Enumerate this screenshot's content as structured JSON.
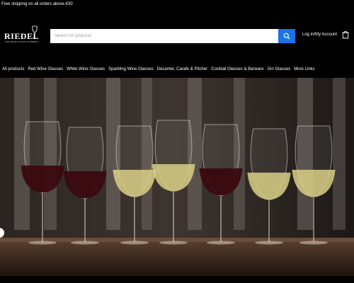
{
  "announcement": {
    "text": "Free shipping on all orders above €30"
  },
  "brand": {
    "name": "RIEDEL",
    "tagline": "THE WINE GLASS COMPANY",
    "icon": "wine-glass-icon"
  },
  "search": {
    "placeholder": "Search for products",
    "icon": "search-icon",
    "button_color": "#1a73e8"
  },
  "account": {
    "label": "Log in/My Account"
  },
  "cart": {
    "icon": "cart-icon"
  },
  "nav": {
    "items": [
      "All products",
      "Red Wine Glasses",
      "White Wine Glasses",
      "Sparkling Wine Glasses",
      "Decanter, Carafe & Pitcher",
      "Cocktail Glasses & Barware",
      "Gin Glasses",
      "More Links"
    ]
  },
  "hero": {
    "image": "Seven wine glasses on a wooden bar, alternating red and white wine",
    "glasses": [
      "red",
      "red",
      "white",
      "white",
      "red",
      "white",
      "white"
    ],
    "colors": {
      "red_wine": "#3a0a10",
      "white_wine": "#d8cf86",
      "bar": "#3b2a1f"
    }
  }
}
